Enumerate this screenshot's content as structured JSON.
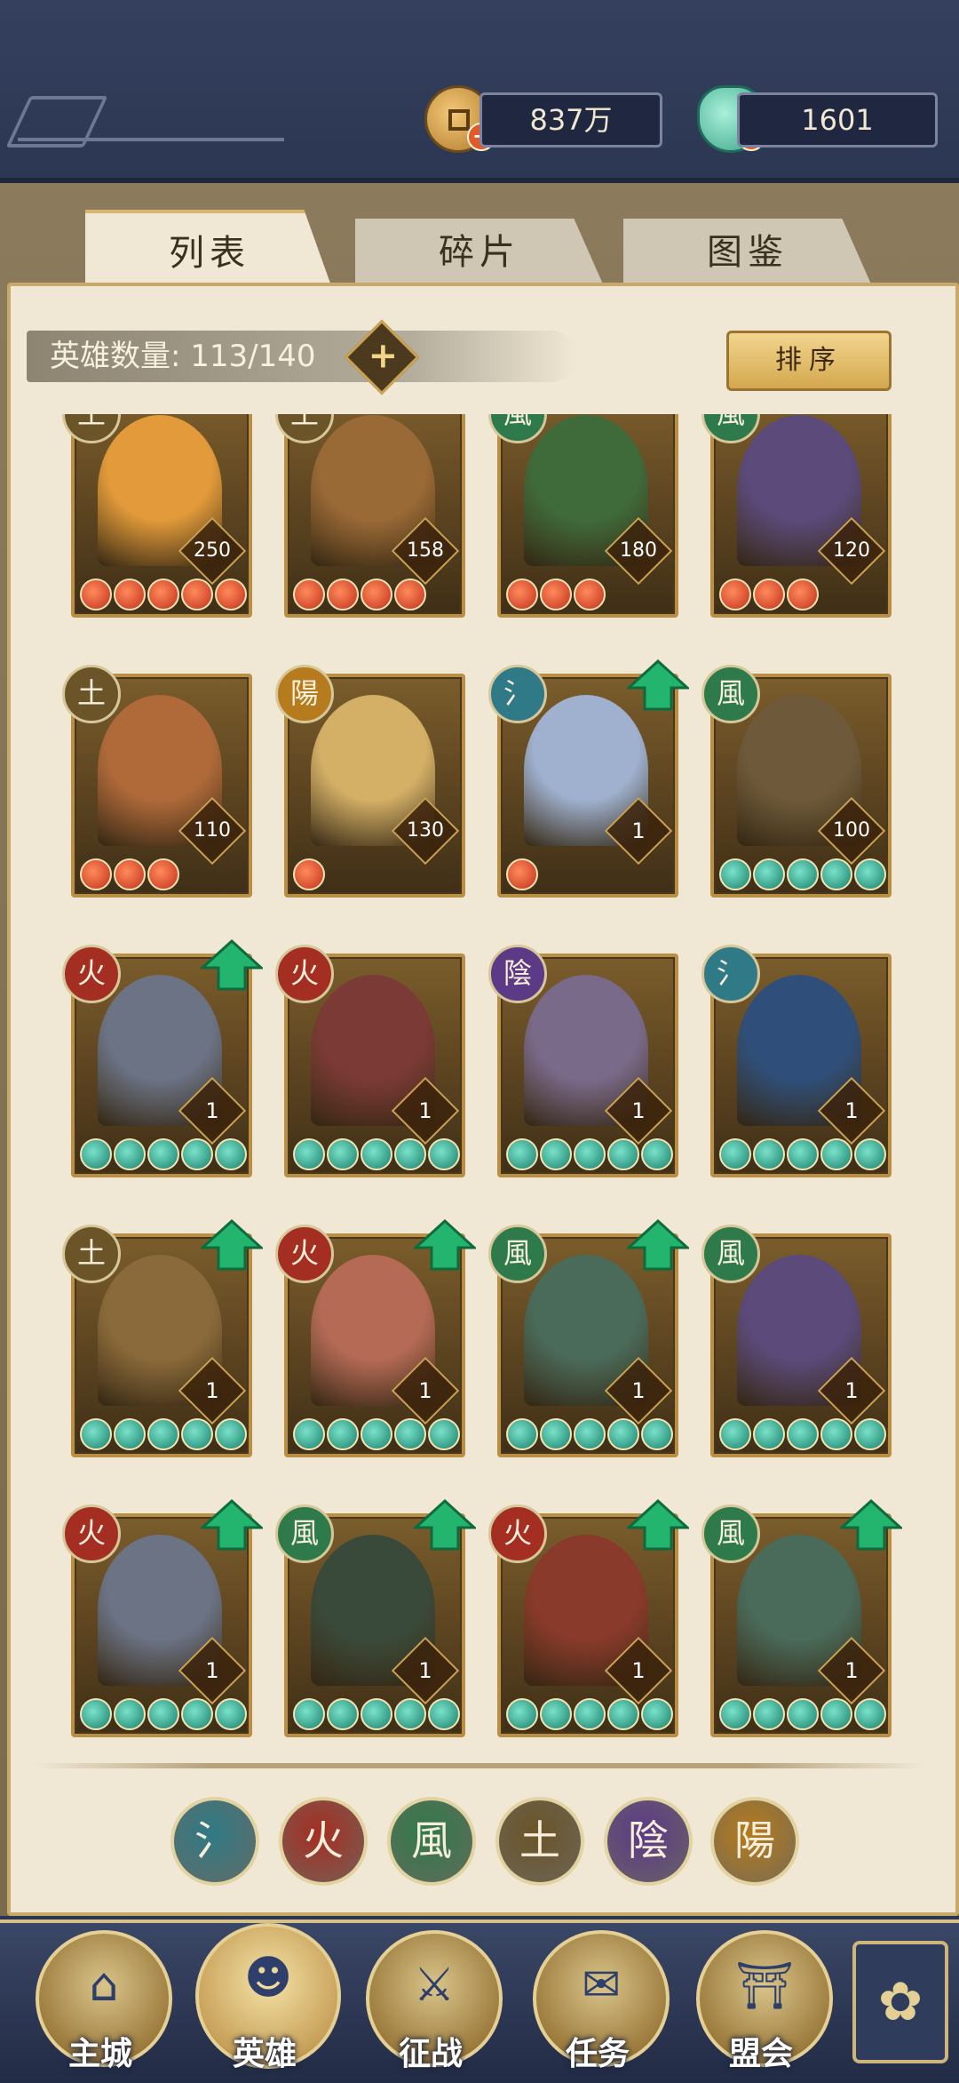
{
  "currency": {
    "coins": "837万",
    "jade": "1601"
  },
  "tabs": [
    "列表",
    "碎片",
    "图鉴"
  ],
  "hero_count_label": "英雄数量: 113/140",
  "sort_label": "排序",
  "colors": {
    "wood_element": "#2f7a86",
    "fire_element": "#a52e22",
    "wind_element": "#2f7a4a",
    "earth_element": "#6b5428",
    "yin_element": "#5c3a86",
    "yang_element": "#b57b1c",
    "upgrade_arrow": "#23b46d"
  },
  "heroes": [
    {
      "element": "土",
      "level": "250",
      "stars": 5,
      "star_color": "red",
      "arrow": false,
      "portrait": "#e29a3a"
    },
    {
      "element": "土",
      "level": "158",
      "stars": 4,
      "star_color": "red",
      "arrow": false,
      "portrait": "#9a6a36"
    },
    {
      "element": "風",
      "level": "180",
      "stars": 3,
      "star_color": "red",
      "arrow": false,
      "portrait": "#3f6b3a"
    },
    {
      "element": "風",
      "level": "120",
      "stars": 3,
      "star_color": "red",
      "arrow": false,
      "portrait": "#5b4a7a"
    },
    {
      "element": "土",
      "level": "110",
      "stars": 3,
      "star_color": "red",
      "arrow": false,
      "portrait": "#b06a3a"
    },
    {
      "element": "陽",
      "level": "130",
      "stars": 1,
      "star_color": "red",
      "arrow": false,
      "portrait": "#d4b067"
    },
    {
      "element": "氵",
      "level": "1",
      "stars": 1,
      "star_color": "red",
      "arrow": true,
      "portrait": "#9fb1cf"
    },
    {
      "element": "風",
      "level": "100",
      "stars": 5,
      "star_color": "teal",
      "arrow": false,
      "portrait": "#6e5a3a"
    },
    {
      "element": "火",
      "level": "1",
      "stars": 5,
      "star_color": "teal",
      "arrow": true,
      "portrait": "#6b7385"
    },
    {
      "element": "火",
      "level": "1",
      "stars": 5,
      "star_color": "teal",
      "arrow": false,
      "portrait": "#7b3a35"
    },
    {
      "element": "陰",
      "level": "1",
      "stars": 5,
      "star_color": "teal",
      "arrow": false,
      "portrait": "#7a6a8a"
    },
    {
      "element": "氵",
      "level": "1",
      "stars": 5,
      "star_color": "teal",
      "arrow": false,
      "portrait": "#2f4f7a"
    },
    {
      "element": "土",
      "level": "1",
      "stars": 5,
      "star_color": "teal",
      "arrow": true,
      "portrait": "#8a6a3a"
    },
    {
      "element": "火",
      "level": "1",
      "stars": 5,
      "star_color": "teal",
      "arrow": true,
      "portrait": "#b46a55"
    },
    {
      "element": "風",
      "level": "1",
      "stars": 5,
      "star_color": "teal",
      "arrow": true,
      "portrait": "#4a6a5a"
    },
    {
      "element": "風",
      "level": "1",
      "stars": 5,
      "star_color": "teal",
      "arrow": false,
      "portrait": "#5b4a7a"
    },
    {
      "element": "火",
      "level": "1",
      "stars": 5,
      "star_color": "teal",
      "arrow": true,
      "portrait": "#6b7385"
    },
    {
      "element": "風",
      "level": "1",
      "stars": 5,
      "star_color": "teal",
      "arrow": true,
      "portrait": "#3a4a3a"
    },
    {
      "element": "火",
      "level": "1",
      "stars": 5,
      "star_color": "teal",
      "arrow": true,
      "portrait": "#8a3a2a"
    },
    {
      "element": "風",
      "level": "1",
      "stars": 5,
      "star_color": "teal",
      "arrow": true,
      "portrait": "#4a6a5a"
    }
  ],
  "element_filters": [
    {
      "glyph": "氵",
      "color": "#2f7a86"
    },
    {
      "glyph": "火",
      "color": "#a52e22"
    },
    {
      "glyph": "風",
      "color": "#2f7a4a"
    },
    {
      "glyph": "土",
      "color": "#6b5428"
    },
    {
      "glyph": "陰",
      "color": "#5c3a86"
    },
    {
      "glyph": "陽",
      "color": "#b57b1c"
    }
  ],
  "nav": [
    {
      "label": "主城",
      "icon": "castle-icon"
    },
    {
      "label": "英雄",
      "icon": "hero-icon"
    },
    {
      "label": "征战",
      "icon": "battle-icon"
    },
    {
      "label": "任务",
      "icon": "quest-icon"
    },
    {
      "label": "盟会",
      "icon": "guild-icon"
    }
  ]
}
